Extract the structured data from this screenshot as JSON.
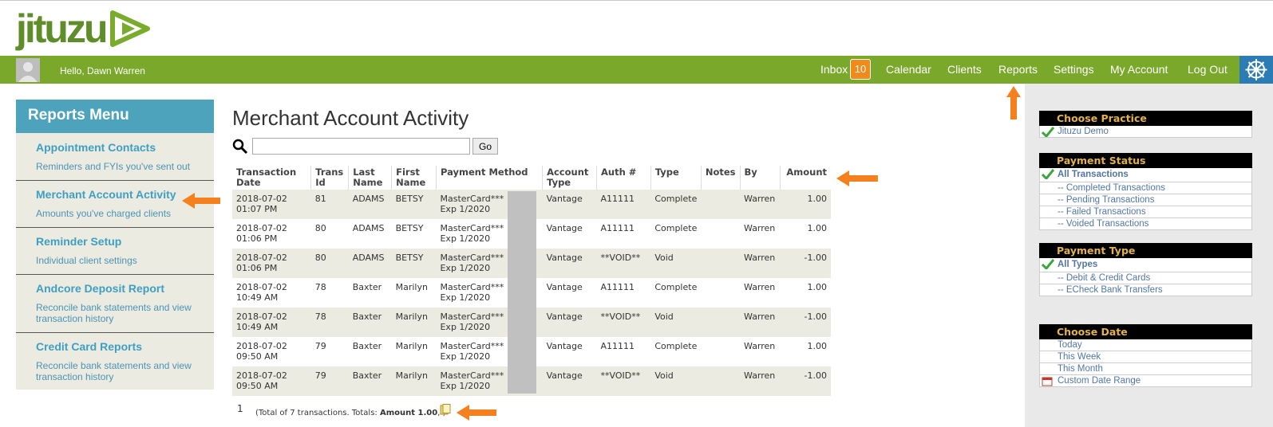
{
  "brand": {
    "logo_text": "jituzu",
    "color": "#79a82a"
  },
  "navbar": {
    "greeting": "Hello, Dawn Warren",
    "inbox_label": "Inbox",
    "inbox_count": "10",
    "items": [
      "Calendar",
      "Clients",
      "Reports",
      "Settings",
      "My Account",
      "Log Out"
    ]
  },
  "sidebar": {
    "title": "Reports Menu",
    "items": [
      {
        "title": "Appointment Contacts",
        "desc": "Reminders and FYIs you've sent out"
      },
      {
        "title": "Merchant Account Activity",
        "desc": "Amounts you've charged clients"
      },
      {
        "title": "Reminder Setup",
        "desc": "Individual client settings"
      },
      {
        "title": "Andcore Deposit Report",
        "desc": "Reconcile bank statements and view transaction history"
      },
      {
        "title": "Credit Card Reports",
        "desc": "Reconcile bank statements and view transaction history"
      }
    ]
  },
  "main": {
    "title": "Merchant Account Activity",
    "search": {
      "value": "",
      "button": "Go"
    },
    "columns": [
      "Transaction Date",
      "Trans Id",
      "Last Name",
      "First Name",
      "Payment Method",
      "Account Type",
      "Auth #",
      "Type",
      "Notes",
      "By",
      "Amount"
    ],
    "rows": [
      {
        "date": "2018-07-02",
        "time": "01:07 PM",
        "id": "81",
        "last": "ADAMS",
        "first": "BETSY",
        "pm1": "MasterCard***",
        "pm2": "Exp 1/2020",
        "acct": "Vantage",
        "auth": "A11111",
        "type": "Complete",
        "notes": "",
        "by": "Warren",
        "amount": "1.00"
      },
      {
        "date": "2018-07-02",
        "time": "01:06 PM",
        "id": "80",
        "last": "ADAMS",
        "first": "BETSY",
        "pm1": "MasterCard***",
        "pm2": "Exp 1/2020",
        "acct": "Vantage",
        "auth": "A11111",
        "type": "Complete",
        "notes": "",
        "by": "Warren",
        "amount": "1.00"
      },
      {
        "date": "2018-07-02",
        "time": "01:06 PM",
        "id": "80",
        "last": "ADAMS",
        "first": "BETSY",
        "pm1": "MasterCard***",
        "pm2": "Exp 1/2020",
        "acct": "Vantage",
        "auth": "**VOID**",
        "type": "Void",
        "notes": "",
        "by": "Warren",
        "amount": "-1.00"
      },
      {
        "date": "2018-07-02",
        "time": "10:49 AM",
        "id": "78",
        "last": "Baxter",
        "first": "Marilyn",
        "pm1": "MasterCard***",
        "pm2": "Exp 1/2020",
        "acct": "Vantage",
        "auth": "A11111",
        "type": "Complete",
        "notes": "",
        "by": "Warren",
        "amount": "1.00"
      },
      {
        "date": "2018-07-02",
        "time": "10:49 AM",
        "id": "78",
        "last": "Baxter",
        "first": "Marilyn",
        "pm1": "MasterCard***",
        "pm2": "Exp 1/2020",
        "acct": "Vantage",
        "auth": "**VOID**",
        "type": "Void",
        "notes": "",
        "by": "Warren",
        "amount": "-1.00"
      },
      {
        "date": "2018-07-02",
        "time": "09:50 AM",
        "id": "79",
        "last": "Baxter",
        "first": "Marilyn",
        "pm1": "MasterCard***",
        "pm2": "Exp 1/2020",
        "acct": "Vantage",
        "auth": "A11111",
        "type": "Complete",
        "notes": "",
        "by": "Warren",
        "amount": "1.00"
      },
      {
        "date": "2018-07-02",
        "time": "09:50 AM",
        "id": "79",
        "last": "Baxter",
        "first": "Marilyn",
        "pm1": "MasterCard***",
        "pm2": "Exp 1/2020",
        "acct": "Vantage",
        "auth": "**VOID**",
        "type": "Void",
        "notes": "",
        "by": "Warren",
        "amount": "-1.00"
      }
    ],
    "pager": "1",
    "totals_prefix": "(Total of 7 transactions. Totals: ",
    "totals_amount": "Amount 1.00",
    "totals_suffix": ", )"
  },
  "filters": {
    "practice": {
      "title": "Choose Practice",
      "items": [
        "Jituzu Demo"
      ]
    },
    "status": {
      "title": "Payment Status",
      "items": [
        "All Transactions",
        "-- Completed Transactions",
        "-- Pending Transactions",
        "-- Failed Transactions",
        "-- Voided Transactions"
      ]
    },
    "ptype": {
      "title": "Payment Type",
      "items": [
        "All Types",
        "-- Debit & Credit Cards",
        "-- ECheck Bank Transfers"
      ]
    },
    "date": {
      "title": "Choose Date",
      "items": [
        "Today",
        "This Week",
        "This Month",
        "Custom Date Range"
      ]
    }
  },
  "colors": {
    "accent": "#79a82a",
    "sidebar_head": "#4ea3bc",
    "annotation_arrow": "#f5801e",
    "filter_header_text": "#e3b24c"
  }
}
